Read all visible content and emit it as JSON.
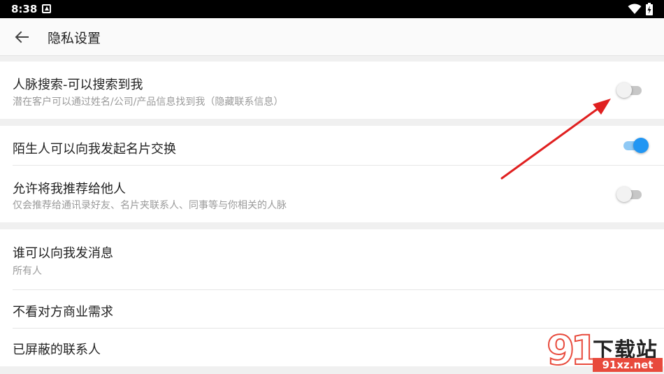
{
  "status_bar": {
    "time": "8:38"
  },
  "header": {
    "title": "隐私设置"
  },
  "sections": {
    "search": {
      "title": "人脉搜索-可以搜索到我",
      "subtitle": "潜在客户可以通过姓名/公司/产品信息找到我（隐藏联系信息）",
      "enabled": false
    },
    "exchange": {
      "title": "陌生人可以向我发起名片交换",
      "enabled": true
    },
    "recommend": {
      "title": "允许将我推荐给他人",
      "subtitle": "仅会推荐给通讯录好友、名片夹联系人、同事等与你相关的人脉",
      "enabled": false
    },
    "messages": {
      "title": "谁可以向我发消息",
      "value": "所有人"
    },
    "hide_demand": {
      "title": "不看对方商业需求"
    },
    "blocked": {
      "title": "已屏蔽的联系人"
    }
  },
  "watermark": {
    "number": "91",
    "brand": "下载站",
    "url": "91xz.net"
  },
  "colors": {
    "accent": "#2196f3",
    "annotation": "#e02020",
    "watermark": "#e84a3c"
  }
}
